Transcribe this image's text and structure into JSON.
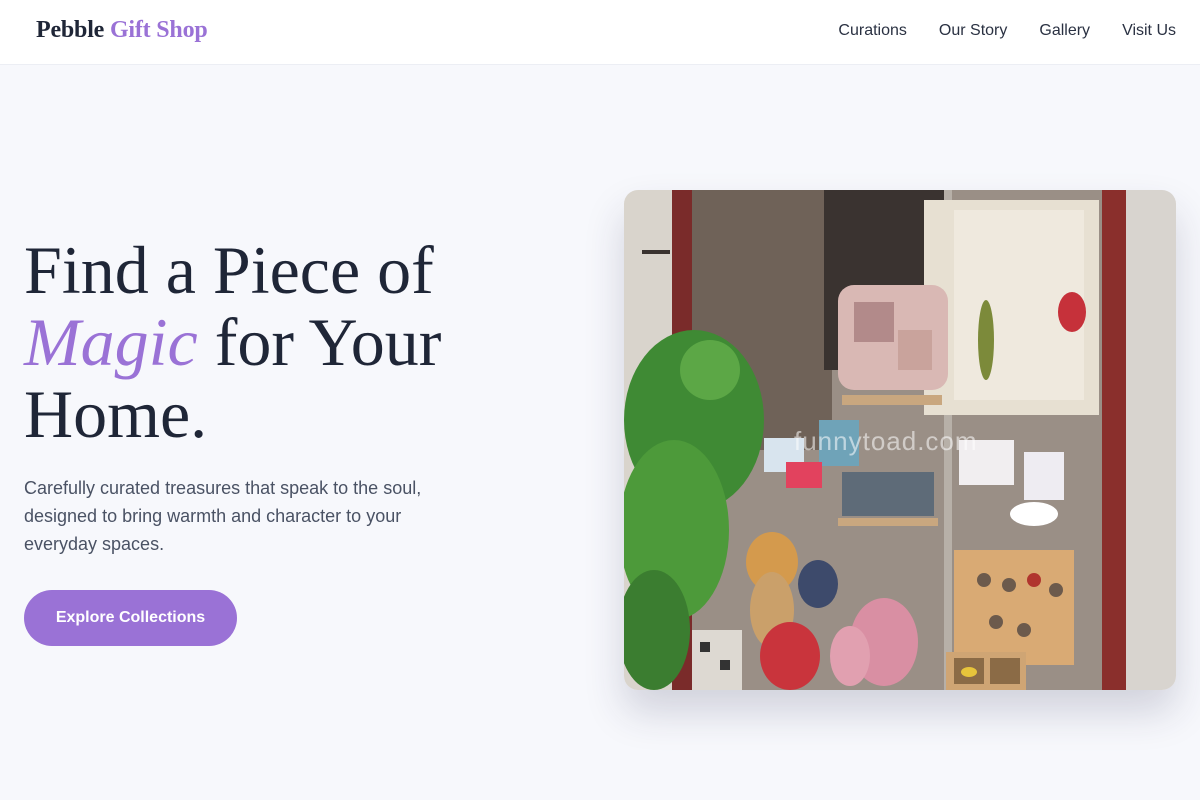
{
  "header": {
    "brand_main": "Pebble",
    "brand_accent": "Gift Shop",
    "nav": [
      {
        "label": "Curations"
      },
      {
        "label": "Our Story"
      },
      {
        "label": "Gallery"
      },
      {
        "label": "Visit Us"
      }
    ]
  },
  "hero": {
    "title_line1": "Find a Piece of",
    "title_magic": "Magic",
    "title_line2_rest": " for Your",
    "title_line3": "Home.",
    "subtitle": "Carefully curated treasures that speak to the soul, designed to bring warmth and character to your everyday spaces.",
    "cta_label": "Explore Collections"
  },
  "image": {
    "watermark": "funnytoad.com"
  },
  "colors": {
    "accent": "#9a72d6",
    "text_dark": "#1f2637",
    "background": "#f7f8fc"
  }
}
